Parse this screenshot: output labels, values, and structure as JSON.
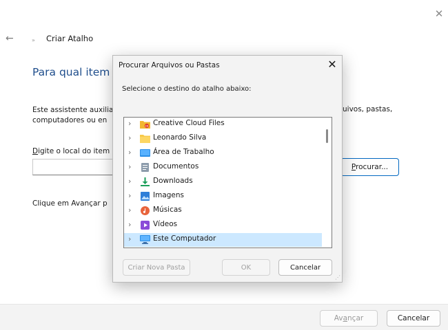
{
  "wizard": {
    "title": "Criar Atalho",
    "heading": "Para qual item v",
    "description": "Este assistente auxilia\ncomputadores ou en",
    "description_right": "uivos, pastas,",
    "location_label_underlined": "D",
    "location_label": "igite o local do item",
    "browse_underlined": "P",
    "browse_label": "rocurar...",
    "next_hint": "Clique em Avançar p",
    "next_label_a": "Av",
    "next_label_u": "a",
    "next_label_b": "nçar",
    "cancel_label": "Cancelar"
  },
  "dialog": {
    "title": "Procurar Arquivos ou Pastas",
    "instruction": "Selecione o destino do atalho abaixo:",
    "items": [
      {
        "label": "Creative Cloud Files",
        "icon": "creative-cloud-folder-icon",
        "color": "#f2b630"
      },
      {
        "label": "Leonardo Silva",
        "icon": "user-folder-icon",
        "color": "#f7c948"
      },
      {
        "label": "Área de Trabalho",
        "icon": "desktop-icon",
        "color": "#2b8ee6"
      },
      {
        "label": "Documentos",
        "icon": "documents-icon",
        "color": "#8c9bab"
      },
      {
        "label": "Downloads",
        "icon": "download-icon",
        "color": "#1b9e5a"
      },
      {
        "label": "Imagens",
        "icon": "pictures-icon",
        "color": "#2f7fd8"
      },
      {
        "label": "Músicas",
        "icon": "music-icon",
        "color": "#e8643c"
      },
      {
        "label": "Vídeos",
        "icon": "videos-icon",
        "color": "#8a4bd8"
      },
      {
        "label": "Este Computador",
        "icon": "computer-icon",
        "color": "#2b8ee6",
        "selected": true
      }
    ],
    "new_folder_label": "Criar Nova Pasta",
    "ok_label": "OK",
    "cancel_label": "Cancelar"
  },
  "colors": {
    "accent": "#0067c0",
    "heading": "#1f4e8c",
    "selection": "#cce8ff"
  }
}
